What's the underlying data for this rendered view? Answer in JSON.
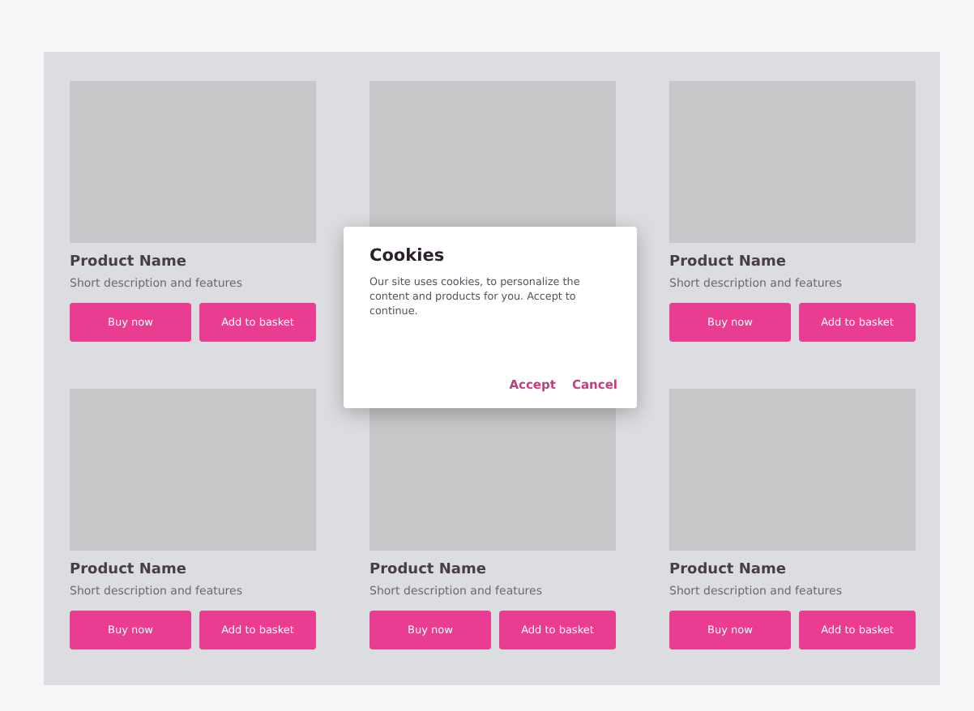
{
  "products": [
    {
      "kind": "full",
      "name": "Product Name",
      "description": "Short description and features",
      "buttons": [
        "Buy now",
        "Add to basket"
      ]
    },
    {
      "kind": "image_only"
    },
    {
      "kind": "full",
      "name": "Product Name",
      "description": "Short description and features",
      "buttons": [
        "Buy now",
        "Add to basket"
      ]
    },
    {
      "kind": "full",
      "name": "Product Name",
      "description": "Short description and features",
      "buttons": [
        "Buy now",
        "Add to basket"
      ]
    },
    {
      "kind": "full",
      "name": "Product Name",
      "description": "Short description and features",
      "buttons": [
        "Buy now",
        "Add to basket"
      ]
    },
    {
      "kind": "full",
      "name": "Product Name",
      "description": "Short description and features",
      "buttons": [
        "Buy now",
        "Add to basket"
      ]
    }
  ],
  "dialog": {
    "title": "Cookies",
    "message": "Our site uses cookies, to personalize the content and products for you. Accept to continue.",
    "buttons": [
      "Accept",
      "Cancel"
    ]
  }
}
